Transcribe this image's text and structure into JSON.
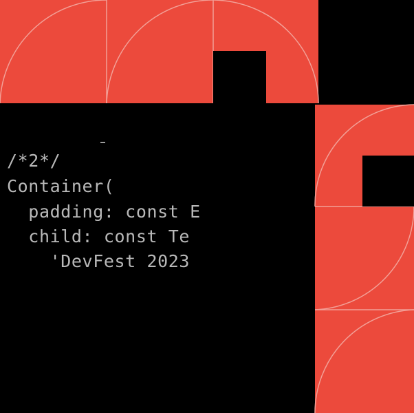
{
  "artwork": {
    "accent_color": "#ec4a3c",
    "line_color": "#f2a097",
    "background_color": "#000000",
    "text_color": "#b9b9b9"
  },
  "code": {
    "lines": [
      "/*2*/",
      "Container(",
      "  padding: const E",
      "  child: const Te",
      "    'DevFest 2023"
    ]
  }
}
